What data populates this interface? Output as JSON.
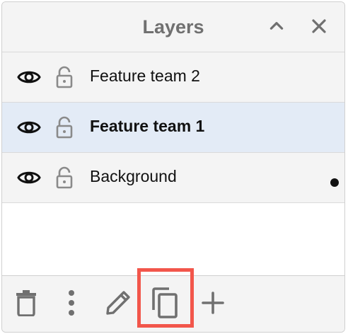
{
  "panel": {
    "title": "Layers",
    "collapse_icon": "chevron-up-icon",
    "close_icon": "close-icon"
  },
  "layers": [
    {
      "name": "Feature team 2",
      "visible": true,
      "locked": false,
      "selected": false,
      "current": false
    },
    {
      "name": "Feature team 1",
      "visible": true,
      "locked": false,
      "selected": true,
      "current": false
    },
    {
      "name": "Background",
      "visible": true,
      "locked": false,
      "selected": false,
      "current": true
    }
  ],
  "toolbar": {
    "items": [
      "trash-icon",
      "more-vertical-icon",
      "pencil-icon",
      "duplicate-icon",
      "plus-icon"
    ]
  },
  "colors": {
    "highlight": "#f2564b",
    "selected_row": "#e3ebf6",
    "icon_gray": "#707070"
  }
}
